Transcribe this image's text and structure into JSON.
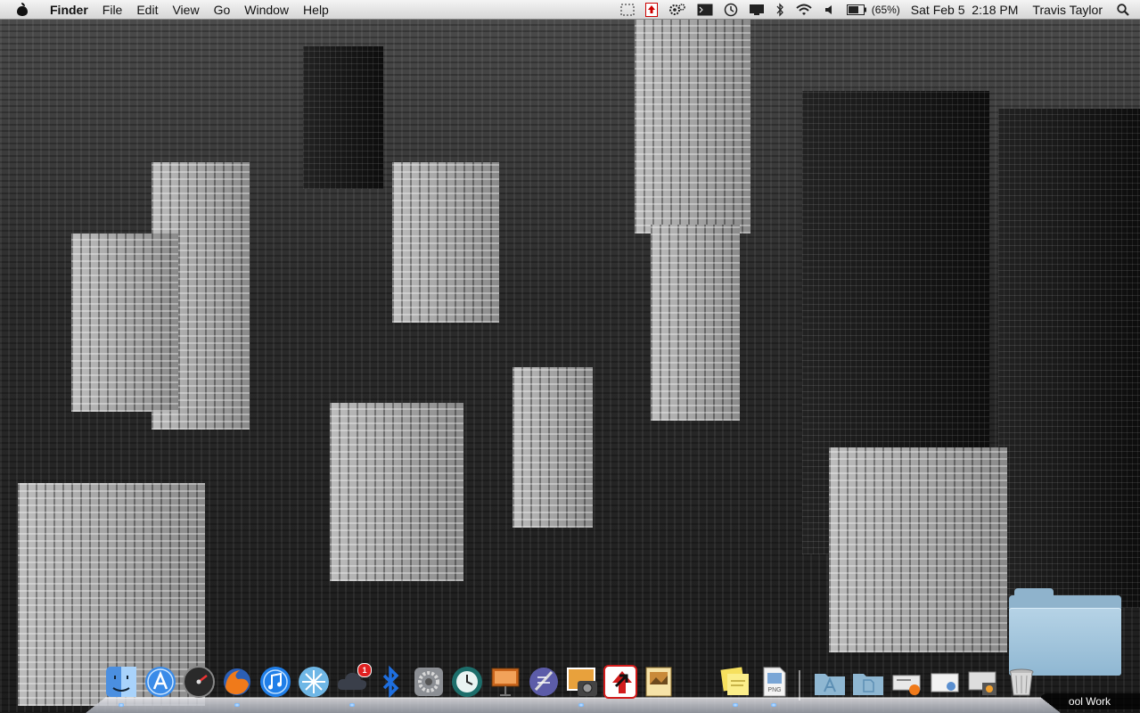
{
  "menubar": {
    "app_name": "Finder",
    "menus": [
      "File",
      "Edit",
      "View",
      "Go",
      "Window",
      "Help"
    ],
    "status": {
      "battery": "(65%)",
      "datetime": "Sat Feb 5  2:18 PM",
      "user": "Travis Taylor"
    }
  },
  "desktop": {
    "folder_label": "ool Work"
  },
  "dock": {
    "badge_count": "1"
  },
  "colors": {
    "menubar_top": "#f4f4f4",
    "menubar_bottom": "#d6d6d6",
    "folder_blue": "#8fb7d2",
    "badge_red": "#e02020",
    "indicator_blue": "#4fa3ff"
  }
}
